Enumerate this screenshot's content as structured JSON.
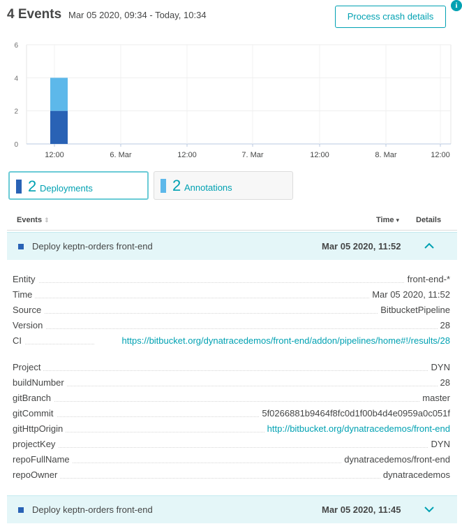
{
  "header": {
    "event_count": "4 Events",
    "time_range": "Mar 05 2020, 09:34 - Today, 10:34",
    "process_button": "Process crash details",
    "info_glyph": "i",
    "info_icon": "info-icon"
  },
  "chart_data": {
    "type": "bar",
    "y_ticks": [
      "0",
      "2",
      "4",
      "6"
    ],
    "ylim": [
      0,
      6
    ],
    "x_ticks": [
      "12:00",
      "6. Mar",
      "12:00",
      "7. Mar",
      "12:00",
      "8. Mar",
      "12:00"
    ],
    "grid": true,
    "bars": [
      {
        "x": "Mar 05 2020, 11:45–12:00",
        "segments": [
          {
            "series": "Deployments",
            "value": 2
          },
          {
            "series": "Annotations",
            "value": 2
          }
        ]
      }
    ],
    "series_colors": {
      "Deployments": "#2962b5",
      "Annotations": "#5db8ea"
    }
  },
  "filters": [
    {
      "count": "2",
      "label": "Deployments",
      "color": "#2962b5",
      "active": true
    },
    {
      "count": "2",
      "label": "Annotations",
      "color": "#5db8ea",
      "active": false
    }
  ],
  "table": {
    "col_events": "Events",
    "col_events_sort_glyph": "⇕",
    "col_time": "Time",
    "col_time_sort_glyph": "▾",
    "col_details": "Details"
  },
  "events": [
    {
      "title": "Deploy keptn-orders front-end",
      "time": "Mar 05 2020, 11:52",
      "expanded": true,
      "chevron_icon": "chevron-up-icon"
    },
    {
      "title": "Deploy keptn-orders front-end",
      "time": "Mar 05 2020, 11:45",
      "expanded": false,
      "chevron_icon": "chevron-down-icon"
    }
  ],
  "event_details": [
    {
      "key": "Entity",
      "value": "front-end-*"
    },
    {
      "key": "Time",
      "value": "Mar 05 2020, 11:52"
    },
    {
      "key": "Source",
      "value": "BitbucketPipeline"
    },
    {
      "key": "Version",
      "value": "28"
    },
    {
      "key": "CI",
      "value": "https://bitbucket.org/dynatracedemos/front-end/addon/pipelines/home#!/results/28",
      "link": true
    },
    {
      "key": "Project",
      "value": "DYN"
    },
    {
      "key": "buildNumber",
      "value": "28"
    },
    {
      "key": "gitBranch",
      "value": "master"
    },
    {
      "key": "gitCommit",
      "value": "5f0266881b9464f8fc0d1f00b4d4e0959a0c051f"
    },
    {
      "key": "gitHttpOrigin",
      "value": "http://bitbucket.org/dynatracedemos/front-end",
      "link": true
    },
    {
      "key": "projectKey",
      "value": "DYN"
    },
    {
      "key": "repoFullName",
      "value": "dynatracedemos/front-end"
    },
    {
      "key": "repoOwner",
      "value": "dynatracedemos"
    }
  ],
  "colors": {
    "accent": "#00a1b2",
    "row_highlight": "#e4f6f8",
    "deploy": "#2962b5",
    "annotation": "#5db8ea"
  }
}
